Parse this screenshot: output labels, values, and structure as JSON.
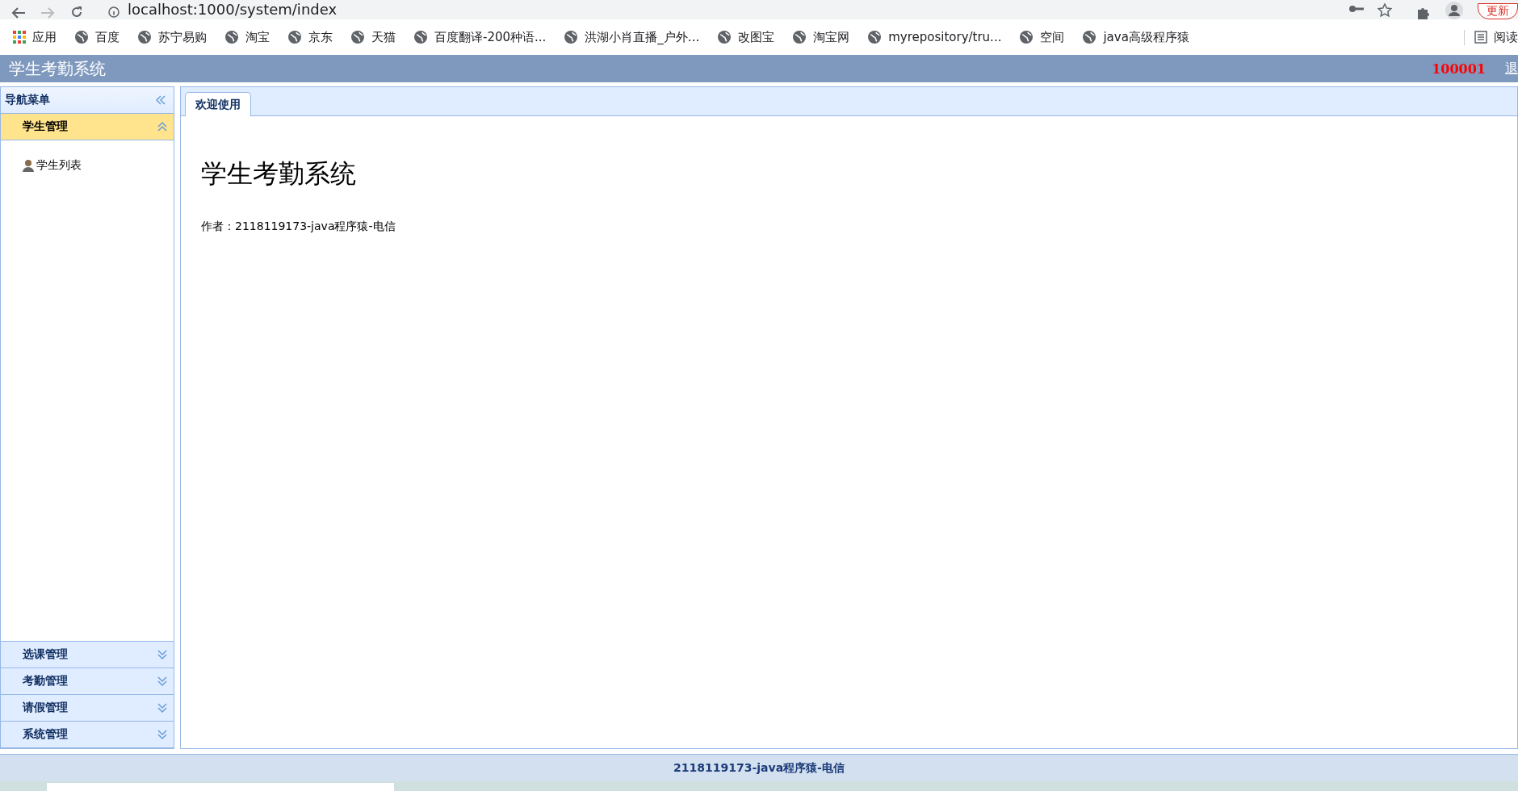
{
  "browser": {
    "address": "localhost:1000/system/index",
    "update_button": "更新",
    "reading_list": "阅读",
    "bookmarks": [
      {
        "label": "应用",
        "kind": "apps"
      },
      {
        "label": "百度",
        "kind": "site"
      },
      {
        "label": "苏宁易购",
        "kind": "site"
      },
      {
        "label": "淘宝",
        "kind": "site"
      },
      {
        "label": "京东",
        "kind": "site"
      },
      {
        "label": "天猫",
        "kind": "site"
      },
      {
        "label": "百度翻译-200种语...",
        "kind": "site"
      },
      {
        "label": "洪湖小肖直播_户外...",
        "kind": "site"
      },
      {
        "label": "改图宝",
        "kind": "site"
      },
      {
        "label": "淘宝网",
        "kind": "site"
      },
      {
        "label": "myrepository/tru...",
        "kind": "site"
      },
      {
        "label": "空间",
        "kind": "site"
      },
      {
        "label": "java高级程序猿",
        "kind": "site"
      }
    ]
  },
  "header": {
    "title": "学生考勤系统",
    "user": "100001",
    "logout": "退"
  },
  "sidebar": {
    "title": "导航菜单",
    "groups": [
      {
        "label": "学生管理",
        "expanded": true,
        "items": [
          {
            "label": "学生列表"
          }
        ]
      },
      {
        "label": "选课管理",
        "expanded": false
      },
      {
        "label": "考勤管理",
        "expanded": false
      },
      {
        "label": "请假管理",
        "expanded": false
      },
      {
        "label": "系统管理",
        "expanded": false
      }
    ]
  },
  "tabs": [
    {
      "label": "欢迎使用",
      "selected": true
    }
  ],
  "content": {
    "heading": "学生考勤系统",
    "author": "作者：2118119173-java程序猿-电信"
  },
  "footer": "2118119173-java程序猿-电信"
}
